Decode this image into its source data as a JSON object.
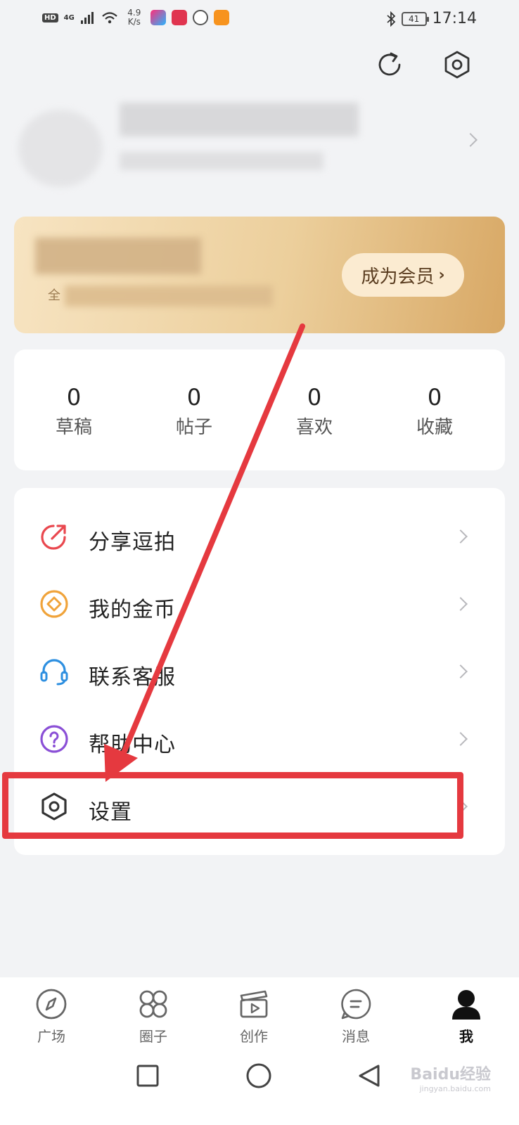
{
  "status_bar": {
    "hd": "HD",
    "network": "4G",
    "speed": "4.9 K/s",
    "battery": "41",
    "time": "17:14"
  },
  "header": {
    "refresh_icon": "refresh-icon",
    "settings_icon": "hexagon-settings-icon"
  },
  "vip": {
    "sub_text": "全",
    "button_label": "成为会员"
  },
  "stats": [
    {
      "value": "0",
      "label": "草稿"
    },
    {
      "value": "0",
      "label": "帖子"
    },
    {
      "value": "0",
      "label": "喜欢"
    },
    {
      "value": "0",
      "label": "收藏"
    }
  ],
  "menu": [
    {
      "label": "分享逗拍",
      "icon": "share-icon",
      "color": "#e9484f"
    },
    {
      "label": "我的金币",
      "icon": "coin-icon",
      "color": "#f0a33a"
    },
    {
      "label": "联系客服",
      "icon": "headset-icon",
      "color": "#2d8fe0"
    },
    {
      "label": "帮助中心",
      "icon": "help-icon",
      "color": "#8a4fd6"
    },
    {
      "label": "设置",
      "icon": "settings-icon",
      "color": "#333333"
    }
  ],
  "bottom_nav": [
    {
      "label": "广场",
      "icon": "compass-icon"
    },
    {
      "label": "圈子",
      "icon": "circles-icon"
    },
    {
      "label": "创作",
      "icon": "clapperboard-icon"
    },
    {
      "label": "消息",
      "icon": "message-icon"
    },
    {
      "label": "我",
      "icon": "profile-icon",
      "active": true
    }
  ],
  "watermark": {
    "text": "Baidu经验",
    "url": "jingyan.baidu.com"
  },
  "colors": {
    "annotation_red": "#e5393f",
    "background": "#f2f3f5"
  }
}
